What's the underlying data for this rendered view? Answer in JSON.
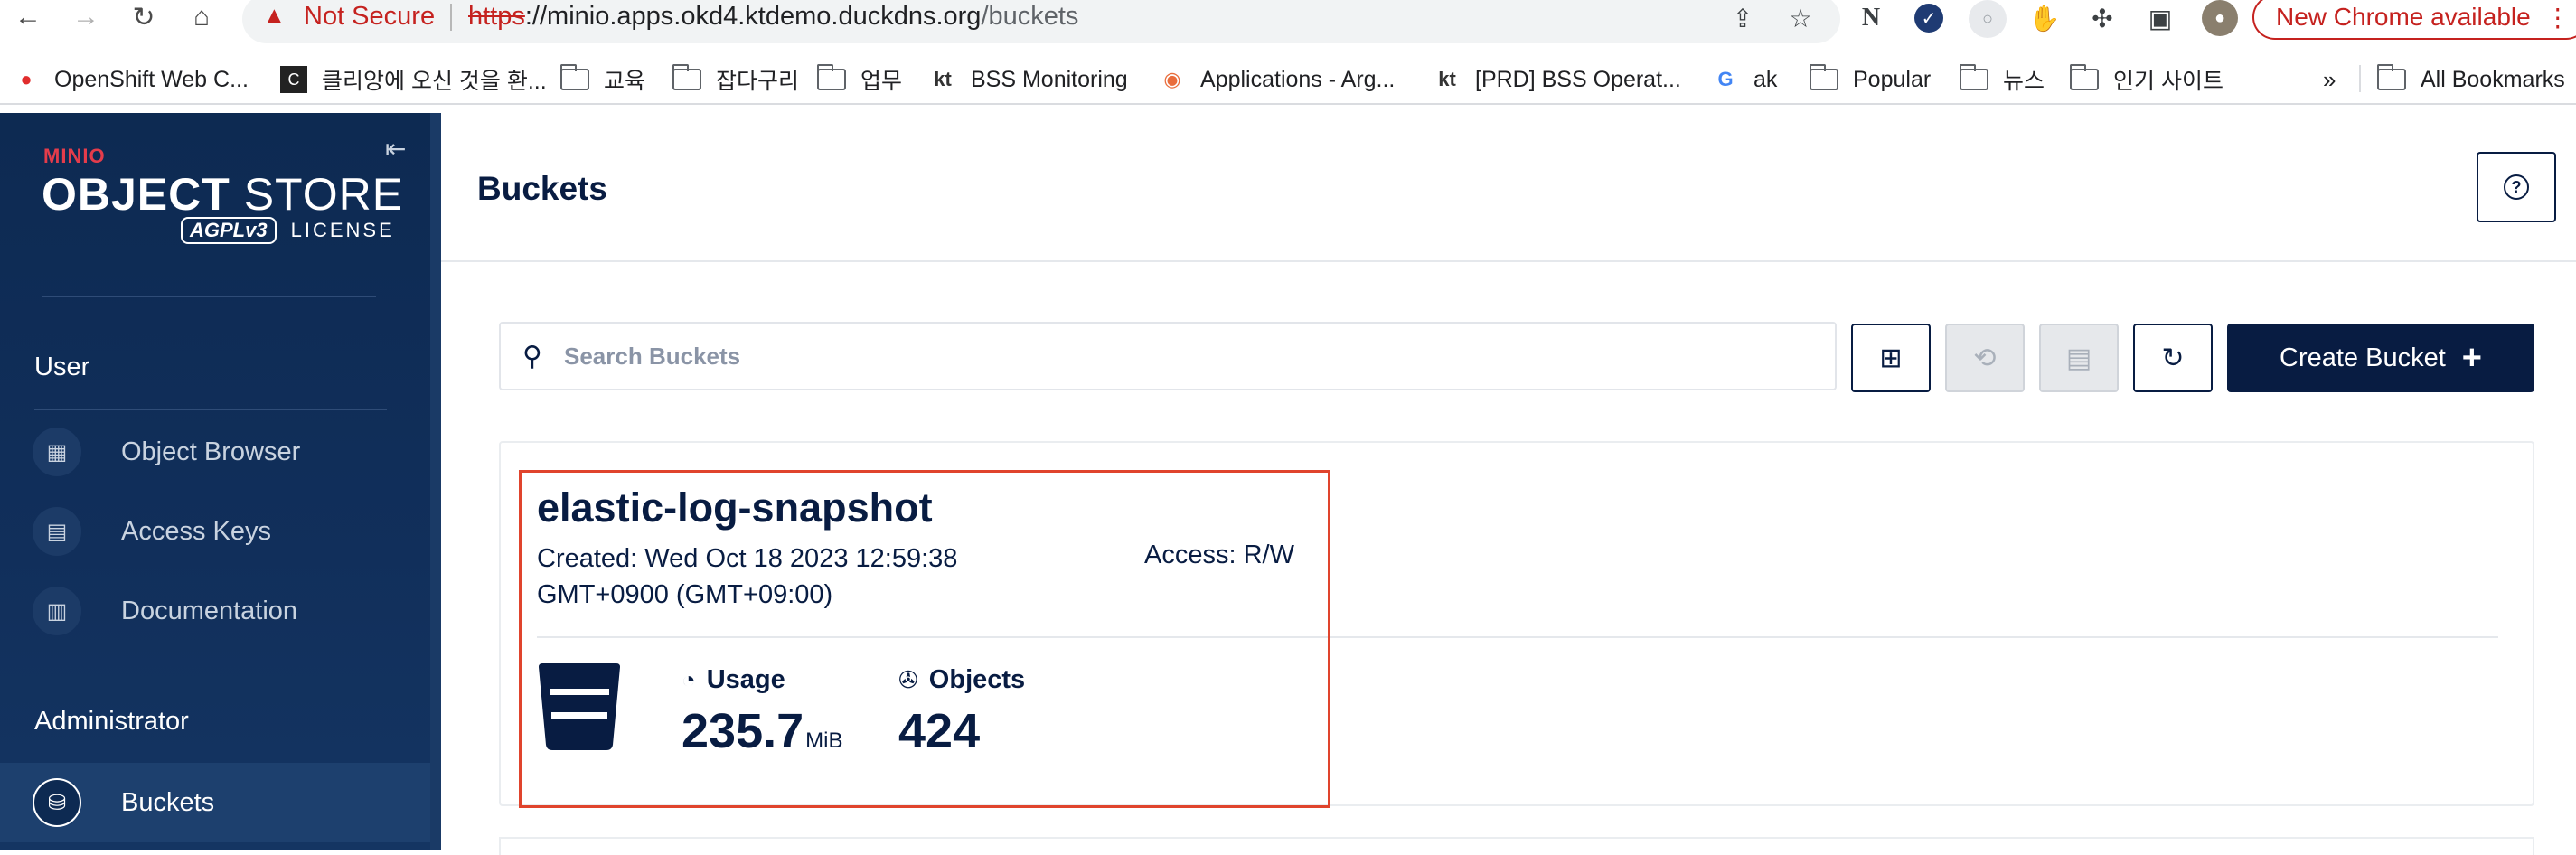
{
  "browser": {
    "security_label": "Not Secure",
    "url_scheme": "https",
    "url_host": "://minio.apps.okd4.ktdemo.duckdns.org",
    "url_path": "/buckets",
    "update_label": "New Chrome available",
    "update_menu_glyph": "⋮",
    "nav_icons": {
      "back": "←",
      "forward": "→",
      "reload": "↻",
      "home": "⌂"
    },
    "ext_letter": "N",
    "bookmarks": [
      {
        "label": "OpenShift Web C...",
        "icon": "openshift-icon"
      },
      {
        "label": "클리앙에 오신 것을 환...",
        "icon": "clien-icon"
      },
      {
        "label": "교육",
        "icon": "folder-icon"
      },
      {
        "label": "잡다구리",
        "icon": "folder-icon"
      },
      {
        "label": "업무",
        "icon": "folder-icon"
      },
      {
        "label": "BSS Monitoring",
        "icon": "kt-icon"
      },
      {
        "label": "Applications - Arg...",
        "icon": "argo-icon"
      },
      {
        "label": "[PRD] BSS Operat...",
        "icon": "kt-icon"
      },
      {
        "label": "ak",
        "icon": "google-icon"
      },
      {
        "label": "Popular",
        "icon": "folder-icon"
      },
      {
        "label": "뉴스",
        "icon": "folder-icon"
      },
      {
        "label": "인기 사이트",
        "icon": "folder-icon"
      }
    ],
    "overflow_label": "»",
    "all_bookmarks_label": "All Bookmarks"
  },
  "sidebar": {
    "logo_brand": "MINIO",
    "logo_title_bold": "OBJECT",
    "logo_title_rest": " STORE",
    "logo_badge": "AGPLv3",
    "logo_license": "LICENSE",
    "collapse_glyph": "⇤",
    "sections": [
      {
        "title": "User",
        "items": [
          {
            "label": "Object Browser",
            "icon": "object-browser-icon"
          },
          {
            "label": "Access Keys",
            "icon": "access-keys-icon"
          },
          {
            "label": "Documentation",
            "icon": "documentation-icon"
          }
        ]
      },
      {
        "title": "Administrator",
        "items": [
          {
            "label": "Buckets",
            "icon": "buckets-icon",
            "active": true
          }
        ]
      }
    ]
  },
  "main": {
    "title": "Buckets",
    "help_glyph": "?",
    "search_placeholder": "Search Buckets",
    "create_label": "Create Bucket",
    "create_plus": "+",
    "bucket": {
      "name": "elastic-log-snapshot",
      "created": "Created: Wed Oct 18 2023 12:59:38 GMT+0900 (GMT+09:00)",
      "access": "Access: R/W",
      "usage_label": "Usage",
      "usage_value": "235.7",
      "usage_unit": "MiB",
      "objects_label": "Objects",
      "objects_value": "424"
    }
  },
  "colors": {
    "sidebar_bg": "#0d2a52",
    "primary": "#081c42",
    "highlight_border": "#e0442d",
    "warning": "#c5221f"
  }
}
